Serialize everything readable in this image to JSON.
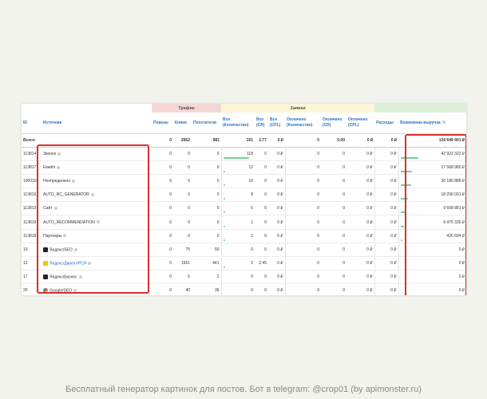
{
  "groups": {
    "traffic": "Трафик",
    "requests": "Заявки"
  },
  "columns": {
    "id": "ID",
    "source": "Источник",
    "shows": "Показы",
    "clicks": "Клики",
    "visitors": "Посетители",
    "all_qty": "Все (Количество)",
    "all_cr": "Все (CR)",
    "all_cpl": "Все (CPL)",
    "paid_qty": "Оплачено (Количество)",
    "paid_cr": "Оплачено (CR)",
    "paid_cpl": "Оплачено (CPL)",
    "expenses": "Расходы",
    "revenue": "Возможная выручка"
  },
  "total": {
    "label": "Всего:",
    "shows": "0",
    "clicks": "2662",
    "visitors": "981",
    "all_qty": "191",
    "all_cr": "2.77",
    "all_cpl": "0 ₽",
    "paid_qty": "0",
    "paid_cr": "0.00",
    "paid_cpl": "0 ₽",
    "expenses": "0 ₽",
    "revenue": "134 649 401 ₽"
  },
  "rows": [
    {
      "id": "113814",
      "source": "Звонок",
      "shows": "0",
      "clicks": "0",
      "visitors": "0",
      "all_qty": "118",
      "all_cr": "0",
      "all_cpl": "0 ₽",
      "paid_qty": "0",
      "paid_cr": "0",
      "paid_cpl": "0 ₽",
      "expenses": "0 ₽",
      "revenue": "42 922 322 ₽",
      "qty_bar": 0.9,
      "rev_bar": 0.55
    },
    {
      "id": "113817",
      "source": "Емейл",
      "shows": "0",
      "clicks": "0",
      "visitors": "0",
      "all_qty": "12",
      "all_cr": "0",
      "all_cpl": "0 ₽",
      "paid_qty": "0",
      "paid_cr": "0",
      "paid_cpl": "0 ₽",
      "expenses": "0 ₽",
      "revenue": "27 568 980 ₽",
      "qty_bar": 0.08,
      "rev_bar": 0.35
    },
    {
      "id": "100016",
      "source": "Неопределено",
      "shows": "0",
      "clicks": "0",
      "visitors": "0",
      "all_qty": "10",
      "all_cr": "0",
      "all_cpl": "0 ₽",
      "paid_qty": "0",
      "paid_cr": "0",
      "paid_cpl": "0 ₽",
      "expenses": "0 ₽",
      "revenue": "26 186 888 ₽",
      "qty_bar": 0.07,
      "rev_bar": 0.33
    },
    {
      "id": "113816",
      "source": "AUTO_RC_GENERATOR",
      "shows": "0",
      "clicks": "0",
      "visitors": "0",
      "all_qty": "8",
      "all_cr": "0",
      "all_cpl": "0 ₽",
      "paid_qty": "0",
      "paid_cr": "0",
      "paid_cpl": "0 ₽",
      "expenses": "0 ₽",
      "revenue": "18 290 001 ₽",
      "qty_bar": 0.05,
      "rev_bar": 0.24
    },
    {
      "id": "113813",
      "source": "Сайт",
      "shows": "0",
      "clicks": "0",
      "visitors": "0",
      "all_qty": "6",
      "all_cr": "0",
      "all_cpl": "0 ₽",
      "paid_qty": "0",
      "paid_cr": "0",
      "paid_cpl": "0 ₽",
      "expenses": "0 ₽",
      "revenue": "9 608 881 ₽",
      "qty_bar": 0.04,
      "rev_bar": 0.13
    },
    {
      "id": "113819",
      "source": "AUTO_RECOMMENDATION",
      "shows": "0",
      "clicks": "0",
      "visitors": "0",
      "all_qty": "1",
      "all_cr": "0",
      "all_cpl": "0 ₽",
      "paid_qty": "0",
      "paid_cr": "0",
      "paid_cpl": "0 ₽",
      "expenses": "0 ₽",
      "revenue": "9 475 335 ₽",
      "qty_bar": 0.01,
      "rev_bar": 0.12
    },
    {
      "id": "113818",
      "source": "Партнеры",
      "shows": "0",
      "clicks": "0",
      "visitors": "0",
      "all_qty": "1",
      "all_cr": "0",
      "all_cpl": "0 ₽",
      "paid_qty": "0",
      "paid_cr": "0",
      "paid_cpl": "0 ₽",
      "expenses": "0 ₽",
      "revenue": "426 694 ₽",
      "qty_bar": 0.01,
      "rev_bar": 0.02
    },
    {
      "id": "10",
      "source": "Яндекс/SEO",
      "shows": "0",
      "clicks": "75",
      "visitors": "50",
      "all_qty": "0",
      "all_cr": "0",
      "all_cpl": "0 ₽",
      "paid_qty": "0",
      "paid_cr": "0",
      "paid_cpl": "0 ₽",
      "expenses": "0 ₽",
      "revenue": "0 ₽",
      "qty_bar": 0,
      "rev_bar": 0,
      "icon": "ic-dark"
    },
    {
      "id": "12",
      "source": "Яндекс/Директ/РСЯ",
      "shows": "0",
      "clicks": "1561",
      "visitors": "441",
      "all_qty": "2",
      "all_cr": "2.45",
      "all_cpl": "0 ₽",
      "paid_qty": "0",
      "paid_cr": "0",
      "paid_cpl": "0 ₽",
      "expenses": "0 ₽",
      "revenue": "0 ₽",
      "qty_bar": 0.01,
      "rev_bar": 0,
      "icon": "ic-yellow",
      "link": true
    },
    {
      "id": "17",
      "source": "Яндекс/Бизнес",
      "shows": "0",
      "clicks": "5",
      "visitors": "2",
      "all_qty": "0",
      "all_cr": "0",
      "all_cpl": "0 ₽",
      "paid_qty": "0",
      "paid_cr": "0",
      "paid_cpl": "0 ₽",
      "expenses": "0 ₽",
      "revenue": "0 ₽",
      "qty_bar": 0,
      "rev_bar": 0,
      "icon": "ic-dark"
    },
    {
      "id": "20",
      "source": "Google/SEO",
      "shows": "0",
      "clicks": "40",
      "visitors": "36",
      "all_qty": "0",
      "all_cr": "0",
      "all_cpl": "0 ₽",
      "paid_qty": "0",
      "paid_cr": "0",
      "paid_cpl": "0 ₽",
      "expenses": "0 ₽",
      "revenue": "0 ₽",
      "qty_bar": 0,
      "rev_bar": 0,
      "icon": "ic-google"
    }
  ],
  "footer": "Бесплатный генератор картинок для постов. Бот в telegram: @crop01 (by apimonster.ru)"
}
